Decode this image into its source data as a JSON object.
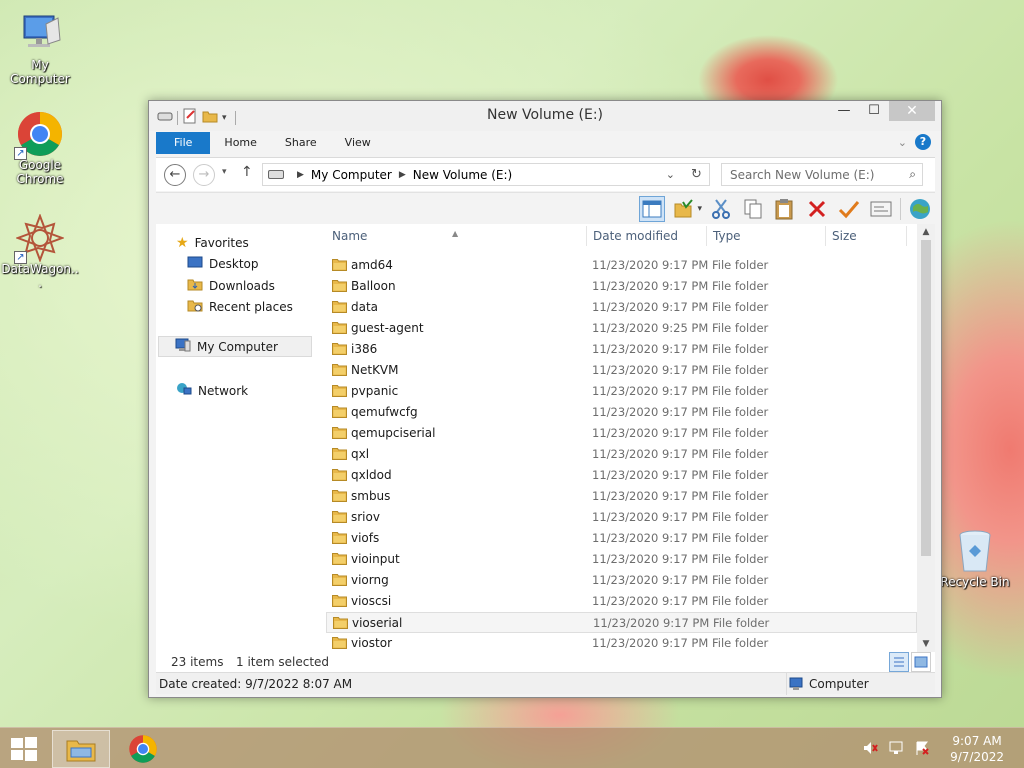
{
  "desktop": {
    "icons": [
      {
        "label": "My Computer",
        "icon": "my-computer-icon"
      },
      {
        "label": "Google Chrome",
        "icon": "chrome-icon"
      },
      {
        "label": "DataWagon...",
        "icon": "datawagon-icon"
      },
      {
        "label": "Recycle Bin",
        "icon": "recycle-bin-icon"
      }
    ]
  },
  "window": {
    "title": "New Volume (E:)",
    "ribbon_tabs": [
      "File",
      "Home",
      "Share",
      "View"
    ],
    "address": {
      "segments": [
        "My Computer",
        "New Volume (E:)"
      ]
    },
    "search_placeholder": "Search New Volume (E:)",
    "nav_pane": {
      "favorites_label": "Favorites",
      "favorites": [
        "Desktop",
        "Downloads",
        "Recent places"
      ],
      "computer_label": "My Computer",
      "network_label": "Network"
    },
    "columns": {
      "name": "Name",
      "date": "Date modified",
      "type": "Type",
      "size": "Size"
    },
    "files": [
      {
        "name": "amd64",
        "date": "11/23/2020 9:17 PM",
        "type": "File folder"
      },
      {
        "name": "Balloon",
        "date": "11/23/2020 9:17 PM",
        "type": "File folder"
      },
      {
        "name": "data",
        "date": "11/23/2020 9:17 PM",
        "type": "File folder"
      },
      {
        "name": "guest-agent",
        "date": "11/23/2020 9:25 PM",
        "type": "File folder"
      },
      {
        "name": "i386",
        "date": "11/23/2020 9:17 PM",
        "type": "File folder"
      },
      {
        "name": "NetKVM",
        "date": "11/23/2020 9:17 PM",
        "type": "File folder"
      },
      {
        "name": "pvpanic",
        "date": "11/23/2020 9:17 PM",
        "type": "File folder"
      },
      {
        "name": "qemufwcfg",
        "date": "11/23/2020 9:17 PM",
        "type": "File folder"
      },
      {
        "name": "qemupciserial",
        "date": "11/23/2020 9:17 PM",
        "type": "File folder"
      },
      {
        "name": "qxl",
        "date": "11/23/2020 9:17 PM",
        "type": "File folder"
      },
      {
        "name": "qxldod",
        "date": "11/23/2020 9:17 PM",
        "type": "File folder"
      },
      {
        "name": "smbus",
        "date": "11/23/2020 9:17 PM",
        "type": "File folder"
      },
      {
        "name": "sriov",
        "date": "11/23/2020 9:17 PM",
        "type": "File folder"
      },
      {
        "name": "viofs",
        "date": "11/23/2020 9:17 PM",
        "type": "File folder"
      },
      {
        "name": "vioinput",
        "date": "11/23/2020 9:17 PM",
        "type": "File folder"
      },
      {
        "name": "viorng",
        "date": "11/23/2020 9:17 PM",
        "type": "File folder"
      },
      {
        "name": "vioscsi",
        "date": "11/23/2020 9:17 PM",
        "type": "File folder"
      },
      {
        "name": "vioserial",
        "date": "11/23/2020 9:17 PM",
        "type": "File folder",
        "selected": true
      },
      {
        "name": "viostor",
        "date": "11/23/2020 9:17 PM",
        "type": "File folder"
      }
    ],
    "status": {
      "item_count": "23 items",
      "selection": "1 item selected"
    },
    "details": {
      "date_created": "Date created: 9/7/2022 8:07 AM",
      "location": "Computer"
    }
  },
  "taskbar": {
    "time": "9:07 AM",
    "date": "9/7/2022"
  },
  "colors": {
    "accent": "#1979ca",
    "file_tab": "#1979ca",
    "folder": "#e8b84a"
  }
}
